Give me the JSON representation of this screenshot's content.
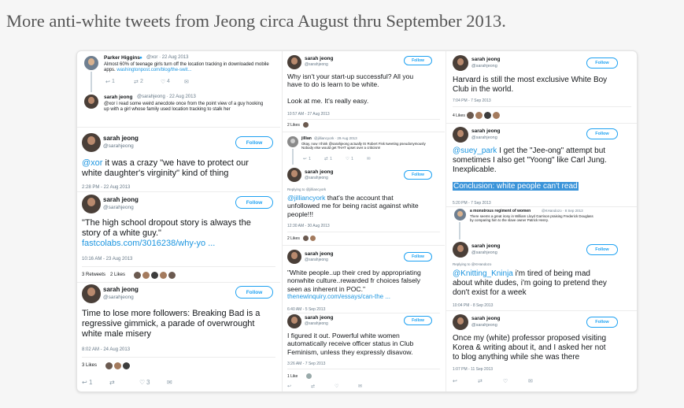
{
  "headline": "More anti-white tweets from Jeong circa August thru September 2013.",
  "colors": {
    "link": "#1b95e0",
    "follow": "#1da1f2",
    "highlight": "#3b94d9",
    "meta": "#657786"
  },
  "follow_label": "Follow",
  "col1": {
    "parker": {
      "name": "Parker Higgins",
      "handle": "@xor · 22 Aug 2013",
      "text_l1": "Almost 60% of teenage girls turn off the location tracking in downloaded mobile",
      "text_l2": "apps.",
      "link": "washingtonpost.com/blog/the-swit...",
      "counts": {
        "reply": "1",
        "retweet": "2",
        "like": "4"
      }
    },
    "reply1": {
      "name": "sarah jeong",
      "handle": "@sarahjeong · 22 Aug 2013",
      "text_l1": "@xor i read some weird anecdote once from the point view of a guy hooking",
      "text_l2": "up with a girl whose family used location tracking to stalk her"
    },
    "t1": {
      "name": "sarah jeong",
      "handle": "@sarahjeong",
      "mention": "@xor",
      "text_l1": "it was a crazy \"we have to protect our",
      "text_l2": "white daughter's virginity\" kind of thing",
      "time": "2:28 PM - 22 Aug 2013"
    },
    "t2": {
      "name": "sarah jeong",
      "handle": "@sarahjeong",
      "text_l1": "\"The high school dropout story is always the",
      "text_l2": "story of a white guy.\"",
      "link": "fastcolabs.com/3016238/why-yo ...",
      "time": "10:16 AM - 23 Aug 2013",
      "retweets": "3 Retweets",
      "likes": "2 Likes"
    },
    "t3": {
      "name": "sarah jeong",
      "handle": "@sarahjeong",
      "text_l1": "Time to lose more followers: Breaking Bad is a",
      "text_l2": "regressive gimmick, a parade of overwrought",
      "text_l3": "white male misery",
      "time": "8:02 AM - 24 Aug 2013",
      "likes": "3 Likes",
      "counts": {
        "reply": "1",
        "like": "3"
      }
    }
  },
  "col2": {
    "t1": {
      "name": "sarah jeong",
      "handle": "@sarahjeong",
      "text_l1": "Why isn't your start-up successful? All you",
      "text_l2": "have to do is learn to be white.",
      "text_l3": "Look at me. It's really easy.",
      "time": "10:57 AM - 27 Aug 2013",
      "likes": "2 Likes"
    },
    "jillian": {
      "name": "jillian",
      "handle": "@jilliancyork · 29 Aug 2013",
      "text_l1": "Okay, now I think @sarahjeong actually IS Robert Fisk tweeting pseudonymously",
      "text_l2": "Nobody else would get THAT upset over a criticism!",
      "counts": {
        "reply": "1",
        "retweet": "1",
        "like": "1"
      }
    },
    "t2": {
      "name": "sarah jeong",
      "handle": "@sarahjeong",
      "replying": "Replying to @jilliancyork",
      "mention": "@jilliancyork",
      "text_l1": "that's the account that",
      "text_l2": "unfollowed me for being racist against white",
      "text_l3": "people!!!",
      "time": "12:30 AM - 30 Aug 2013",
      "likes": "2 Likes"
    },
    "t3": {
      "name": "sarah jeong",
      "handle": "@sarahjeong",
      "text_l1": "\"White people..up their cred by appropriating",
      "text_l2": "nonwhite culture..rewarded fr choices falsely",
      "text_l3": "seen as inherent in POC.\"",
      "link": "thenewinquiry.com/essays/can-the ...",
      "time": "6:40 AM - 5 Sep 2013",
      "likes": "2 Likes"
    },
    "t4": {
      "name": "sarah jeong",
      "handle": "@sarahjeong",
      "text_l1": "I figured it out. Powerful white women",
      "text_l2": "automatically receive officer status in Club",
      "text_l3": "Feminism, unless they expressly disavow.",
      "time": "3:26 AM - 7 Sep 2013",
      "likes": "1 Like"
    }
  },
  "col3": {
    "t1": {
      "name": "sarah jeong",
      "handle": "@sarahjeong",
      "text_l1": "Harvard is still the most exclusive White Boy",
      "text_l2": "Club in the world.",
      "time": "7:04 PM - 7 Sep 2013",
      "likes": "4 Likes"
    },
    "t2": {
      "name": "sarah jeong",
      "handle": "@sarahjeong",
      "mention": "@suey_park",
      "text_l1": "I get the \"Jee-ong\" attempt but",
      "text_l2": "sometimes I also get \"Yoong\" like Carl Jung.",
      "text_l3": "Inexplicable.",
      "highlight": "Conclusion: white people can't read",
      "time": "5:20 PM - 7 Sep 2013"
    },
    "monstrous": {
      "name": "a monstrous regiment of women",
      "handle": "@KHandozo · 8 Sep 2013",
      "text_l1": "There seems a great irony in William Lloyd Garrison praising Frederick Douglass",
      "text_l2": "by comparing him to the slave owner Patrick Henry."
    },
    "t3": {
      "name": "sarah jeong",
      "handle": "@sarahjeong",
      "replying": "Replying to @KHandozo",
      "mention": "@Knitting_Kninja",
      "text_l1": "i'm tired of being mad",
      "text_l2": "about white dudes, i'm going to pretend they",
      "text_l3": "don't exist for a week",
      "time": "10:04 PM - 8 Sep 2013"
    },
    "t4": {
      "name": "sarah jeong",
      "handle": "@sarahjeong",
      "text_l1": "Once my (white) professor proposed visiting",
      "text_l2": "Korea & writing about it, and I asked her not",
      "text_l3": "to blog anything while she was there",
      "time": "1:07 PM - 11 Sep 2013"
    }
  }
}
